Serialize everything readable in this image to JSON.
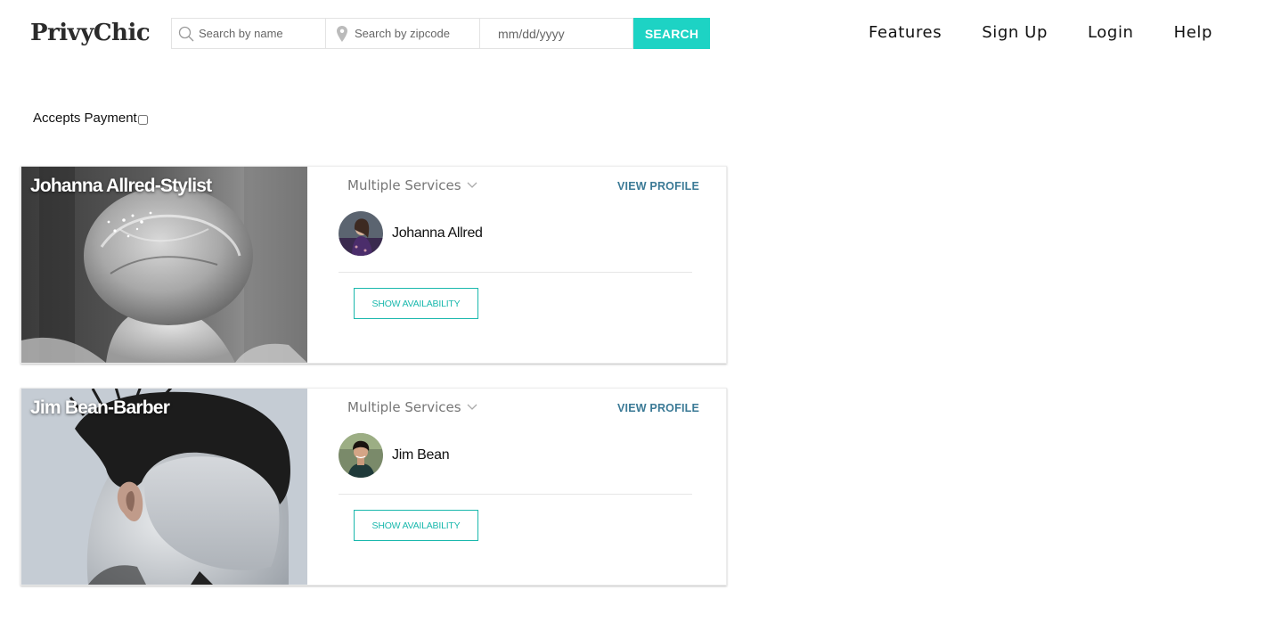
{
  "header": {
    "logo": "PrivyChic",
    "search": {
      "name_placeholder": "Search by name",
      "zip_placeholder": "Search by zipcode",
      "date_placeholder": "mm/dd/yyyy",
      "button_label": "SEARCH"
    },
    "nav": [
      "Features",
      "Sign Up",
      "Login",
      "Help"
    ]
  },
  "filter": {
    "label": "Accepts Payment",
    "checked": false
  },
  "colors": {
    "accent": "#1dd3c4",
    "link": "#3b7a96"
  },
  "listings": [
    {
      "title": "Johanna Allred-Stylist",
      "services_label": "Multiple Services",
      "view_profile": "VIEW PROFILE",
      "stylist_name": "Johanna Allred",
      "availability_label": "SHOW AVAILABILITY"
    },
    {
      "title": "Jim Bean-Barber",
      "services_label": "Multiple Services",
      "view_profile": "VIEW PROFILE",
      "stylist_name": "Jim Bean",
      "availability_label": "SHOW AVAILABILITY"
    }
  ]
}
